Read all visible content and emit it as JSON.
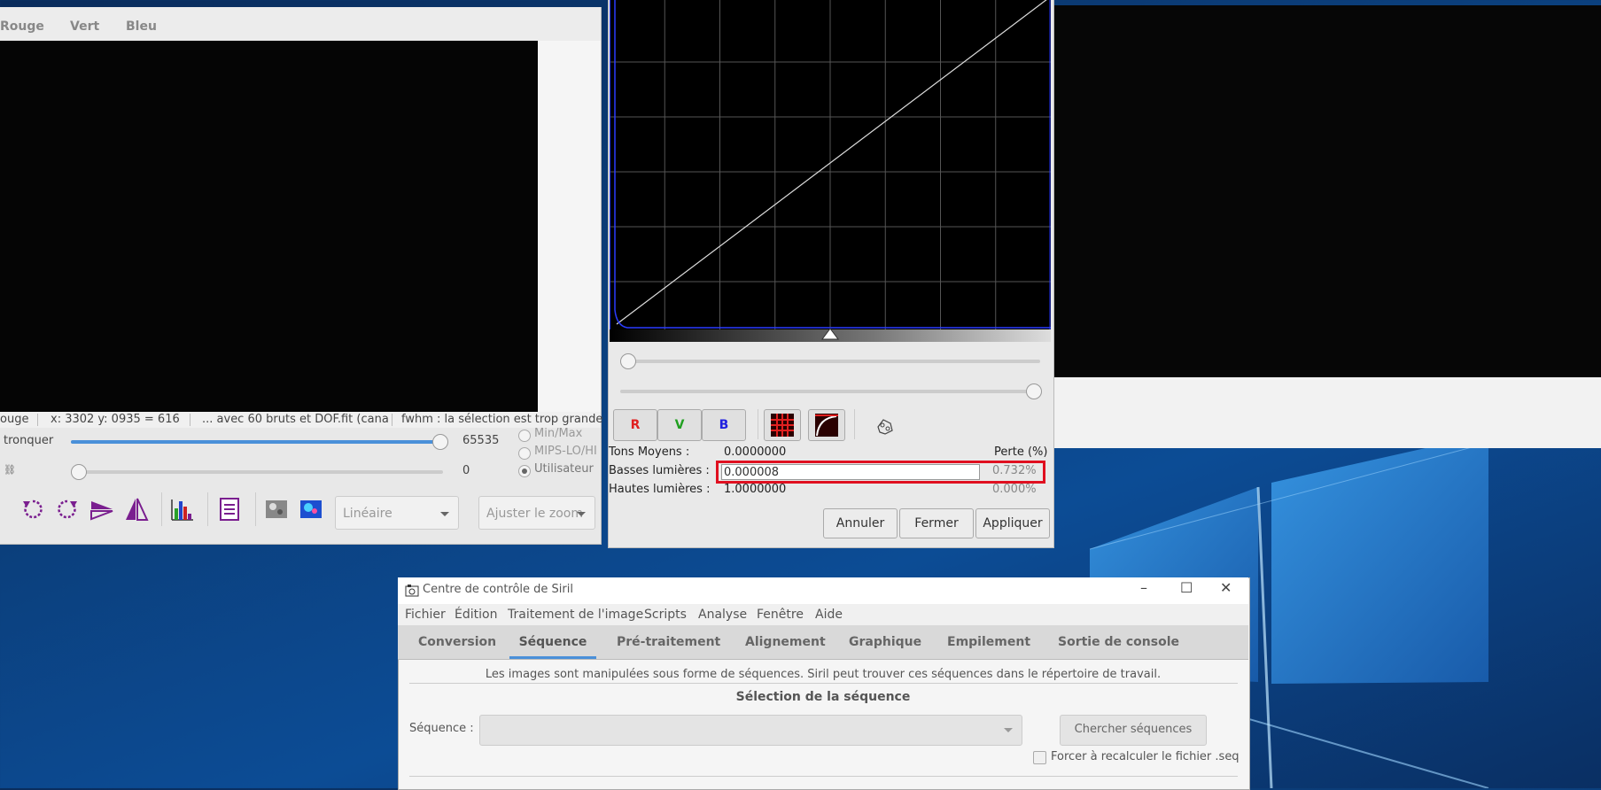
{
  "left_window": {
    "tabs": [
      {
        "label": "Rouge",
        "active": true
      },
      {
        "label": "Vert",
        "active": false
      },
      {
        "label": "Bleu",
        "active": false
      }
    ],
    "status": {
      "channel": "ouge",
      "coords": "x: 3302 y: 0935 = 616",
      "file": "... avec 60 bruts et DOF.fit (cana",
      "message": "fwhm : la sélection est trop grande"
    },
    "high_slider": {
      "label": "tronquer",
      "value": "65535",
      "fraction": 0.99
    },
    "low_slider": {
      "value": "0",
      "fraction": 0.0
    },
    "scale_options": [
      {
        "label": "Min/Max",
        "selected": false
      },
      {
        "label": "MIPS-LO/HI",
        "selected": false
      },
      {
        "label": "Utilisateur",
        "selected": true
      }
    ],
    "display_mode": "Linéaire",
    "zoom_label": "Ajuster le zoom",
    "toolbar_icons": [
      "rotate-left-icon",
      "rotate-right-icon",
      "mirror-horizontal-icon",
      "mirror-vertical-icon",
      "histogram-icon",
      "checklist-icon",
      "grayscale-preview-icon",
      "color-preview-icon"
    ]
  },
  "histogram_dialog": {
    "channel_buttons": [
      {
        "label": "R",
        "color": "#e02020"
      },
      {
        "label": "V",
        "color": "#20a020"
      },
      {
        "label": "B",
        "color": "#2020e0"
      }
    ],
    "stats": {
      "midtones_label": "Tons Moyens :",
      "midtones_value": "0.0000000",
      "loss_header": "Perte (%)",
      "shadows_label": "Basses lumières :",
      "shadows_value": "0.000008",
      "shadows_loss": "0.732%",
      "highlights_label": "Hautes lumières :",
      "highlights_value": "1.0000000",
      "highlights_loss": "0.000%"
    },
    "buttons": {
      "cancel": "Annuler",
      "close": "Fermer",
      "apply": "Appliquer"
    },
    "shadows_slider_fraction": 0.0,
    "highlights_slider_fraction": 1.0,
    "midtones_marker_fraction": 0.5
  },
  "siril": {
    "title": "Centre de contrôle de Siril",
    "menu": [
      "Fichier",
      "Édition",
      "Traitement de l'image",
      "Scripts",
      "Analyse",
      "Fenêtre",
      "Aide"
    ],
    "tabs": [
      {
        "label": "Conversion",
        "active": false
      },
      {
        "label": "Séquence",
        "active": true
      },
      {
        "label": "Pré-traitement",
        "active": false
      },
      {
        "label": "Alignement",
        "active": false
      },
      {
        "label": "Graphique",
        "active": false
      },
      {
        "label": "Empilement",
        "active": false
      },
      {
        "label": "Sortie de console",
        "active": false
      }
    ],
    "info_text": "Les images sont manipulées sous forme de séquences. Siril peut trouver ces séquences dans le répertoire de travail.",
    "section_title": "Sélection de la séquence",
    "sequence_label": "Séquence :",
    "sequence_value": "",
    "search_button": "Chercher séquences",
    "recompute_label": "Forcer à recalculer le fichier .seq",
    "recompute_checked": false
  }
}
